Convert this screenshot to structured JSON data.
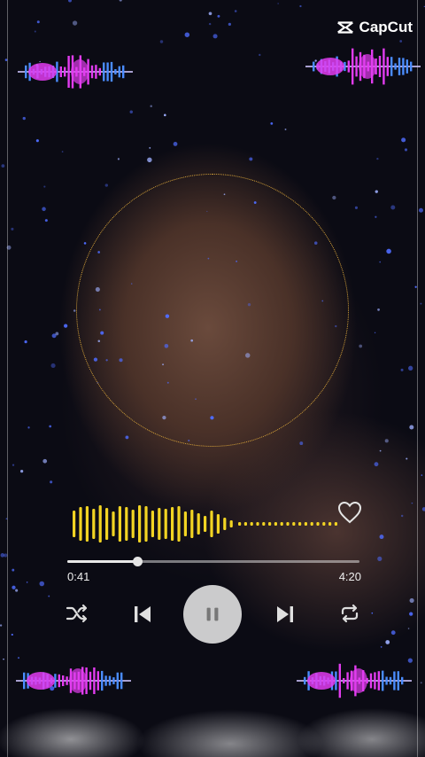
{
  "app": {
    "logo_text": "CapCut",
    "logo_icon": "capcut-icon"
  },
  "player": {
    "current_time": "0:41",
    "total_time": "4:20",
    "progress": 0.24,
    "liked": false
  },
  "icons": {
    "shuffle": "shuffle-icon",
    "previous": "skip-previous-icon",
    "play_pause": "pause-icon",
    "next": "skip-next-icon",
    "repeat": "repeat-icon",
    "like": "heart-icon"
  },
  "colors": {
    "waveform": "#f2d423",
    "ring": "#d9a53a",
    "badge_magenta": "#e23cf0",
    "badge_blue": "#4a8cff"
  }
}
